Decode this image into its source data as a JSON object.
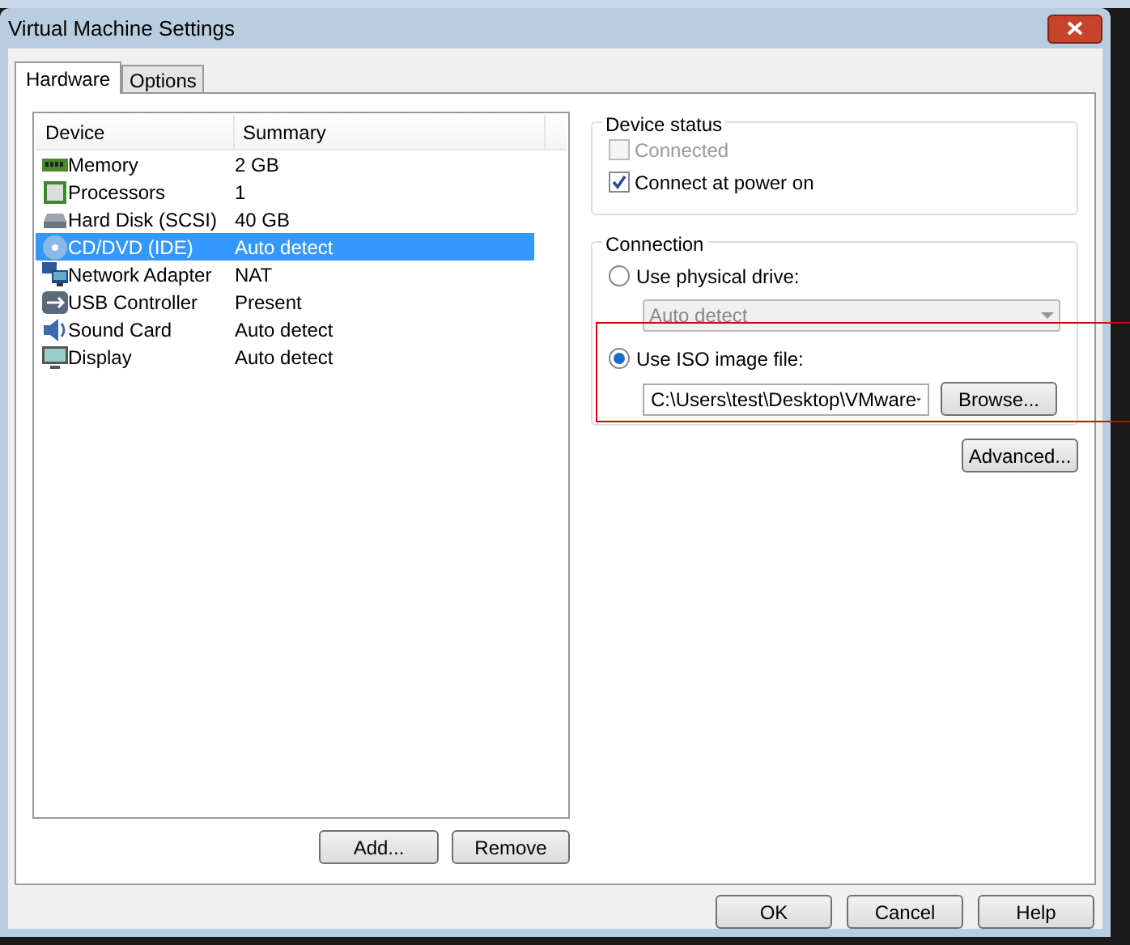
{
  "window": {
    "title": "Virtual Machine Settings"
  },
  "tabs": [
    {
      "label": "Hardware",
      "selected": true
    },
    {
      "label": "Options",
      "selected": false
    }
  ],
  "devices": {
    "columns": [
      "Device",
      "Summary"
    ],
    "rows": [
      {
        "kind": "memory",
        "name": "Memory",
        "summary": "2 GB",
        "selected": false
      },
      {
        "kind": "processor",
        "name": "Processors",
        "summary": "1",
        "selected": false
      },
      {
        "kind": "disk",
        "name": "Hard Disk (SCSI)",
        "summary": "40 GB",
        "selected": false
      },
      {
        "kind": "cd",
        "name": "CD/DVD (IDE)",
        "summary": "Auto detect",
        "selected": true
      },
      {
        "kind": "network",
        "name": "Network Adapter",
        "summary": "NAT",
        "selected": false
      },
      {
        "kind": "usb",
        "name": "USB Controller",
        "summary": "Present",
        "selected": false
      },
      {
        "kind": "sound",
        "name": "Sound Card",
        "summary": "Auto detect",
        "selected": false
      },
      {
        "kind": "display",
        "name": "Display",
        "summary": "Auto detect",
        "selected": false
      }
    ],
    "buttons": [
      "Add...",
      "Remove"
    ]
  },
  "device_status": {
    "title": "Device status",
    "options": [
      {
        "label": "Connected",
        "checked": false,
        "disabled": true
      },
      {
        "label": "Connect at power on",
        "checked": true,
        "disabled": false
      }
    ]
  },
  "connection": {
    "title": "Connection",
    "physical": {
      "label": "Use physical drive:",
      "selected": false,
      "value": "Auto detect",
      "disabled": true
    },
    "iso": {
      "label": "Use ISO image file:",
      "selected": true,
      "value": "C:\\Users\\test\\Desktop\\VMware",
      "browse": "Browse..."
    },
    "advanced": "Advanced..."
  },
  "footer_buttons": [
    "OK",
    "Cancel",
    "Help"
  ]
}
